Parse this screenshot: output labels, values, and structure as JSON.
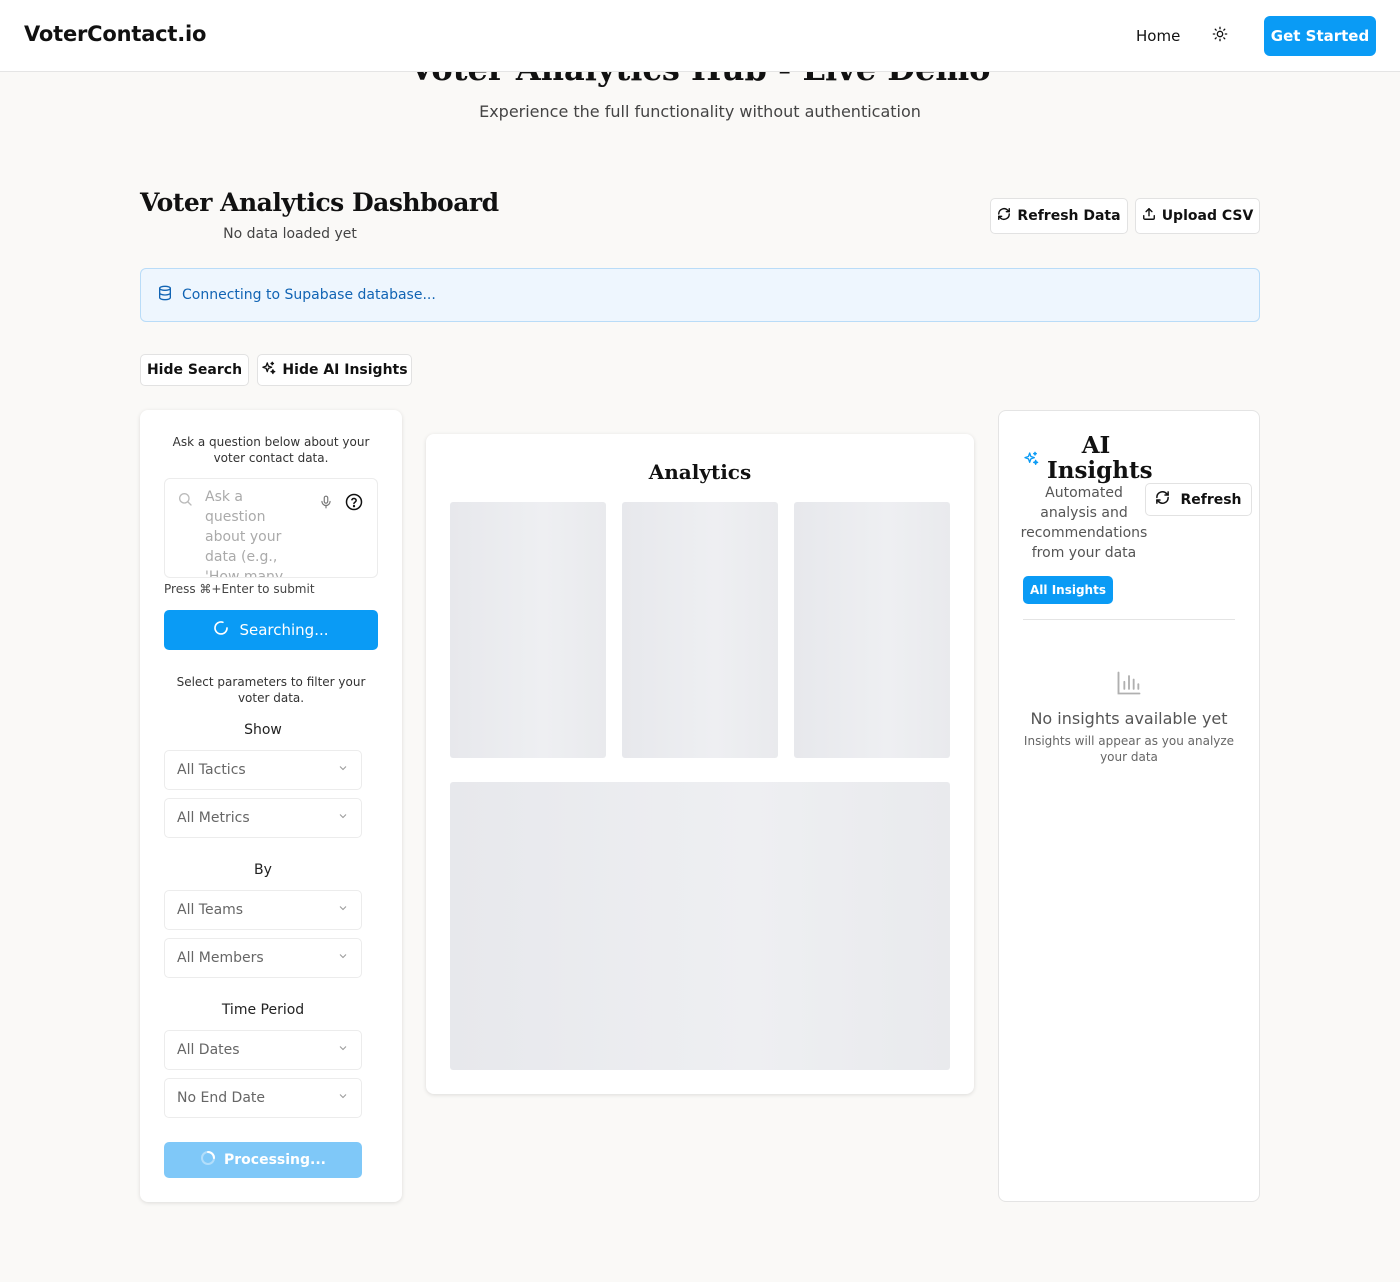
{
  "nav": {
    "brand": "VoterContact.io",
    "home": "Home",
    "cta": "Get Started"
  },
  "hero": {
    "title": "Voter Analytics Hub - Live Demo",
    "subtitle": "Experience the full functionality without authentication"
  },
  "dashboard": {
    "title": "Voter Analytics Dashboard",
    "status": "No data loaded yet",
    "refresh_label": "Refresh Data",
    "upload_label": "Upload CSV",
    "alert": "Connecting to Supabase database...",
    "hide_search_label": "Hide Search",
    "hide_ai_label": "Hide AI Insights"
  },
  "search_panel": {
    "intro": "Ask a question below about your voter contact data.",
    "placeholder": "Ask a question about your data (e.g., 'How many",
    "hint": "Press ⌘+Enter to submit",
    "search_button": "Searching...",
    "filter_intro": "Select parameters to filter your voter data.",
    "show_label": "Show",
    "by_label": "By",
    "time_label": "Time Period",
    "tactics": "All Tactics",
    "metrics": "All Metrics",
    "teams": "All Teams",
    "members": "All Members",
    "start_date": "All Dates",
    "end_date": "No End Date",
    "process_button": "Processing..."
  },
  "analytics": {
    "title": "Analytics"
  },
  "insights": {
    "title": "AI Insights",
    "description": "Automated analysis and recommendations from your data",
    "refresh_label": "Refresh",
    "filter_pill": "All Insights",
    "empty_title": "No insights available yet",
    "empty_subtitle": "Insights will appear as you analyze your data"
  },
  "colors": {
    "accent": "#0a9bf5",
    "alert_bg": "#eef6fe",
    "alert_text": "#1164b4"
  }
}
